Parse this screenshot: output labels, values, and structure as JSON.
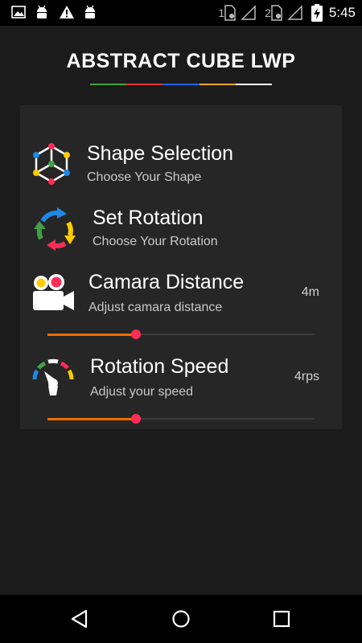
{
  "status_bar": {
    "time": "5:45",
    "sim1_label": "1",
    "sim2_label": "2",
    "icons": [
      "image-icon",
      "android-icon",
      "warning-icon",
      "android-icon",
      "sim-icon",
      "signal-icon",
      "sim-icon",
      "signal-icon",
      "battery-charging-icon"
    ]
  },
  "header": {
    "title": "ABSTRACT CUBE LWP",
    "underline_colors": [
      "#43a047",
      "#e53935",
      "#1e63e9",
      "#f9a825",
      "#ffffff"
    ]
  },
  "settings": {
    "shape": {
      "title": "Shape Selection",
      "subtitle": "Choose Your Shape",
      "icon": "cube-icon"
    },
    "rotation": {
      "title": "Set Rotation",
      "subtitle": "Choose Your Rotation",
      "icon": "rotation-arrows-icon"
    },
    "distance": {
      "title": "Camara Distance",
      "subtitle": "Adjust camara distance",
      "value": "4m",
      "icon": "video-camera-icon",
      "slider_fraction": 0.33
    },
    "speed": {
      "title": "Rotation Speed",
      "subtitle": "Adjust your speed",
      "value": "4rps",
      "icon": "speedometer-icon",
      "slider_fraction": 0.33
    }
  },
  "colors": {
    "accent_orange": "#ef6c00",
    "thumb_pink": "#ff2d55"
  },
  "nav_bar": {
    "icons": [
      "back-icon",
      "home-icon",
      "recents-icon"
    ]
  }
}
